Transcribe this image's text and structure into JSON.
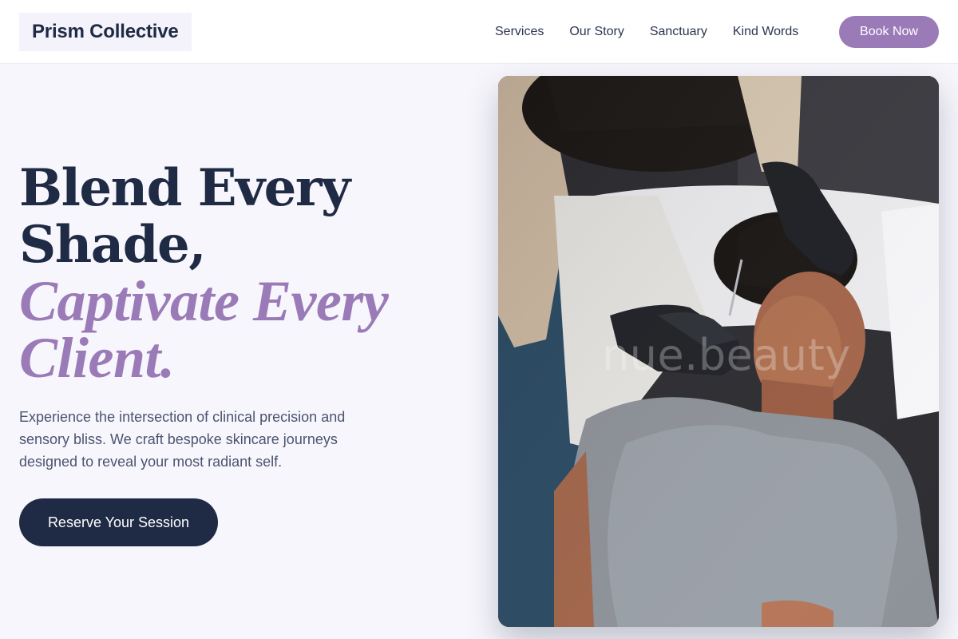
{
  "header": {
    "brand": "Prism Collective",
    "nav": [
      {
        "label": "Services"
      },
      {
        "label": "Our Story"
      },
      {
        "label": "Sanctuary"
      },
      {
        "label": "Kind Words"
      }
    ],
    "cta_label": "Book Now"
  },
  "hero": {
    "headline_line1": "Blend Every Shade,",
    "headline_line2": "Captivate Every Client.",
    "description": "Experience the intersection of clinical precision and sensory bliss. We craft bespoke skincare journeys designed to reveal your most radiant self.",
    "cta_label": "Reserve Your Session",
    "image_watermark": "nue.beauty"
  },
  "colors": {
    "accent": "#9b7ab8",
    "navy": "#1f2a44",
    "background": "#f7f6fc"
  }
}
